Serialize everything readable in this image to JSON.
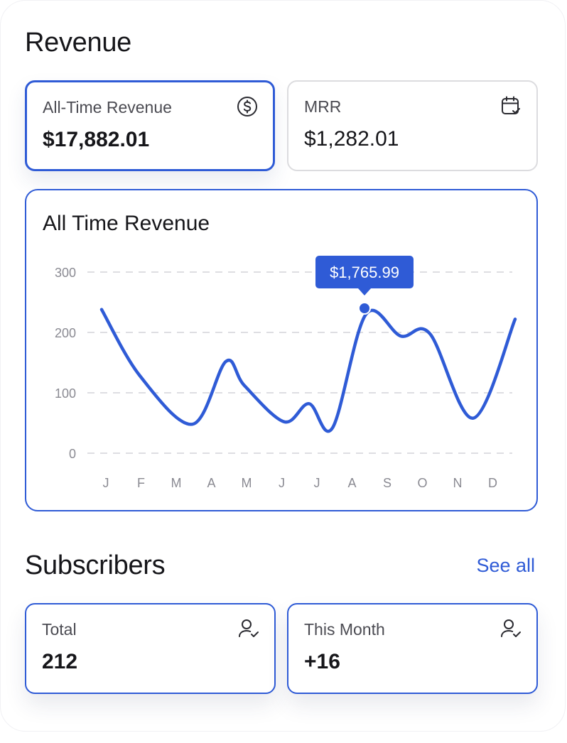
{
  "revenue": {
    "title": "Revenue",
    "cards": [
      {
        "label": "All-Time Revenue",
        "value": "$17,882.01",
        "icon": "dollar-circle-icon"
      },
      {
        "label": "MRR",
        "value": "$1,282.01",
        "icon": "calendar-check-icon"
      }
    ]
  },
  "chart": {
    "title": "All Time Revenue",
    "tooltip": "$1,765.99",
    "accent": "#2f5bd6",
    "chart_data": {
      "type": "line",
      "title": "All Time Revenue",
      "xlabel": "",
      "ylabel": "",
      "ylim": [
        0,
        300
      ],
      "yticks": [
        "0",
        "100",
        "200",
        "300"
      ],
      "categories": [
        "J",
        "F",
        "M",
        "A",
        "M",
        "J",
        "J",
        "A",
        "S",
        "O",
        "N",
        "D"
      ],
      "values": [
        238,
        128,
        48,
        152,
        112,
        52,
        82,
        42,
        230,
        194,
        198,
        58,
        222
      ],
      "highlight": {
        "category": "A",
        "value": 240,
        "label": "$1,765.99"
      },
      "grid": true,
      "grid_style": "dashed"
    }
  },
  "subscribers": {
    "title": "Subscribers",
    "see_all": "See all",
    "cards": [
      {
        "label": "Total",
        "value": "212",
        "icon": "user-check-icon"
      },
      {
        "label": "This Month",
        "value": "+16",
        "icon": "user-check-icon"
      }
    ]
  }
}
